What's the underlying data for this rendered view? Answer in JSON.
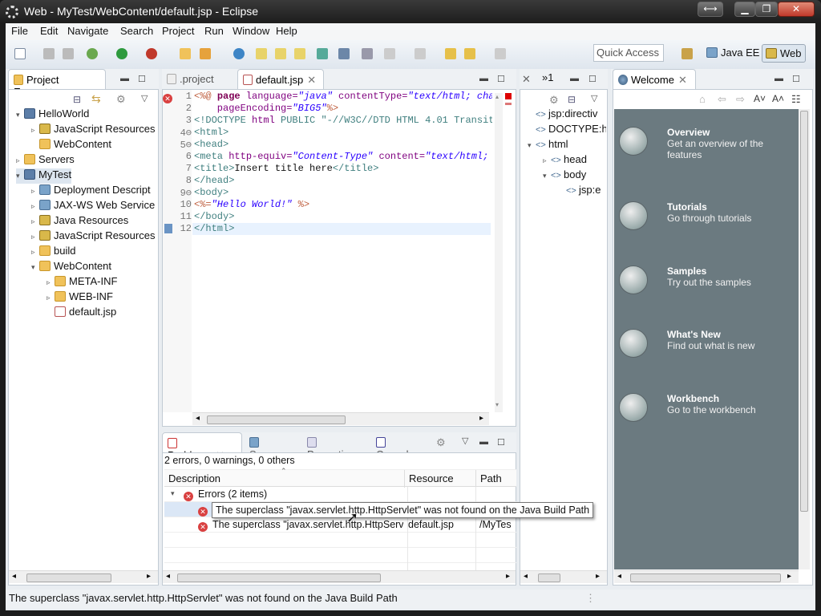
{
  "window": {
    "title": "Web - MyTest/WebContent/default.jsp - Eclipse"
  },
  "menu": [
    "File",
    "Edit",
    "Navigate",
    "Search",
    "Project",
    "Run",
    "Window",
    "Help"
  ],
  "toolbar": {
    "quick_access": "Quick Access",
    "perspectives": [
      "Java EE",
      "Web"
    ]
  },
  "project_explorer": {
    "tab_label": "Project Exp...",
    "tree": [
      {
        "label": "HelloWorld",
        "depth": 0,
        "icon": "project-icon",
        "arrow": "▾"
      },
      {
        "label": "JavaScript Resources",
        "depth": 1,
        "icon": "js-resources-icon",
        "arrow": "▹"
      },
      {
        "label": "WebContent",
        "depth": 1,
        "icon": "folder-icon",
        "arrow": ""
      },
      {
        "label": "Servers",
        "depth": 0,
        "icon": "folder-icon",
        "arrow": "▹"
      },
      {
        "label": "MyTest",
        "depth": 0,
        "icon": "project-error-icon",
        "arrow": "▾"
      },
      {
        "label": "Deployment Descript",
        "depth": 1,
        "icon": "deployment-icon",
        "arrow": "▹"
      },
      {
        "label": "JAX-WS Web Service",
        "depth": 1,
        "icon": "webservice-icon",
        "arrow": "▹"
      },
      {
        "label": "Java Resources",
        "depth": 1,
        "icon": "java-resources-icon",
        "arrow": "▹"
      },
      {
        "label": "JavaScript Resources",
        "depth": 1,
        "icon": "js-resources-icon",
        "arrow": "▹"
      },
      {
        "label": "build",
        "depth": 1,
        "icon": "folder-icon",
        "arrow": "▹"
      },
      {
        "label": "WebContent",
        "depth": 1,
        "icon": "folder-error-icon",
        "arrow": "▾"
      },
      {
        "label": "META-INF",
        "depth": 2,
        "icon": "folder-icon",
        "arrow": "▹"
      },
      {
        "label": "WEB-INF",
        "depth": 2,
        "icon": "folder-icon",
        "arrow": "▹"
      },
      {
        "label": "default.jsp",
        "depth": 2,
        "icon": "jsp-file-error-icon",
        "arrow": ""
      }
    ]
  },
  "editor": {
    "tabs": [
      ".project",
      "default.jsp"
    ],
    "active_tab": "default.jsp",
    "line_numbers": [
      "1",
      "2",
      "3",
      "4",
      "5",
      "6",
      "7",
      "8",
      "9",
      "10",
      "11",
      "12"
    ],
    "fold_markers": {
      "4": "⊖",
      "5": "⊖",
      "9": "⊖"
    },
    "lines": [
      [
        {
          "t": "<%@ ",
          "c": "jsp"
        },
        {
          "t": "page ",
          "c": "kw"
        },
        {
          "t": "language=",
          "c": "attr"
        },
        {
          "t": "\"java\"",
          "c": "str"
        },
        {
          "t": " contentType=",
          "c": "attr"
        },
        {
          "t": "\"text/html; char",
          "c": "str"
        }
      ],
      [
        {
          "t": "    pageEncoding=",
          "c": "attr"
        },
        {
          "t": "\"BIG5\"",
          "c": "str"
        },
        {
          "t": "%>",
          "c": "jsp"
        }
      ],
      [
        {
          "t": "<!DOCTYPE ",
          "c": "tag"
        },
        {
          "t": "html ",
          "c": "attr"
        },
        {
          "t": "PUBLIC ",
          "c": "tag"
        },
        {
          "t": "\"-//W3C//DTD HTML 4.01 Transiti",
          "c": "tag"
        }
      ],
      [
        {
          "t": "<html>",
          "c": "tag"
        }
      ],
      [
        {
          "t": "<head>",
          "c": "tag"
        }
      ],
      [
        {
          "t": "<meta ",
          "c": "tag"
        },
        {
          "t": "http-equiv=",
          "c": "attr"
        },
        {
          "t": "\"Content-Type\"",
          "c": "str"
        },
        {
          "t": " content=",
          "c": "attr"
        },
        {
          "t": "\"text/html; c",
          "c": "str"
        }
      ],
      [
        {
          "t": "<title>",
          "c": "tag"
        },
        {
          "t": "Insert title here",
          "c": ""
        },
        {
          "t": "</title>",
          "c": "tag"
        }
      ],
      [
        {
          "t": "</head>",
          "c": "tag"
        }
      ],
      [
        {
          "t": "<body>",
          "c": "tag"
        }
      ],
      [
        {
          "t": "<%=",
          "c": "jsp"
        },
        {
          "t": "\"Hello World!\"",
          "c": "str"
        },
        {
          "t": " %>",
          "c": "jsp"
        }
      ],
      [
        {
          "t": "</body>",
          "c": "tag"
        }
      ],
      [
        {
          "t": "</html>",
          "c": "tag"
        }
      ]
    ]
  },
  "outline": {
    "tab_label": "»1",
    "tree": [
      {
        "label": "jsp:directiv",
        "arrow": ""
      },
      {
        "label": "DOCTYPE:h",
        "arrow": ""
      },
      {
        "label": "html",
        "arrow": "▾"
      },
      {
        "label": "head",
        "arrow": "▹"
      },
      {
        "label": "body",
        "arrow": "▾"
      },
      {
        "label": "jsp:e",
        "arrow": ""
      }
    ]
  },
  "welcome": {
    "tab_label": "Welcome",
    "items": [
      {
        "title": "Overview",
        "desc": "Get an overview of the features",
        "icon": "globe-icon"
      },
      {
        "title": "Tutorials",
        "desc": "Go through tutorials",
        "icon": "tutorials-icon"
      },
      {
        "title": "Samples",
        "desc": "Try out the samples",
        "icon": "samples-icon"
      },
      {
        "title": "What's New",
        "desc": "Find out what is new",
        "icon": "star-icon"
      },
      {
        "title": "Workbench",
        "desc": "Go to the workbench",
        "icon": "workbench-icon"
      }
    ]
  },
  "problems": {
    "tabs": [
      "Problems",
      "Servers",
      "Properties",
      "Console"
    ],
    "summary": "2 errors, 0 warnings, 0 others",
    "columns": [
      "Description",
      "Resource",
      "Path"
    ],
    "group": "Errors (2 items)",
    "rows": [
      {
        "description": "The superclass \"javax.servlet.http.HttpServlet\" was not found on the Java Build Path",
        "resource": "",
        "path": ""
      },
      {
        "description": "The superclass \"javax.servlet.http.HttpServl",
        "resource": "default.jsp",
        "path": "/MyTes"
      }
    ],
    "tooltip": "The superclass \"javax.servlet.http.HttpServlet\" was not found on the Java Build Path"
  },
  "status_bar": {
    "message": "The superclass \"javax.servlet.http.HttpServlet\" was not found on the Java Build Path"
  },
  "colors": {
    "welcome_bg": "#6b7a80",
    "error": "#d94040",
    "accent": "#3875d7"
  }
}
